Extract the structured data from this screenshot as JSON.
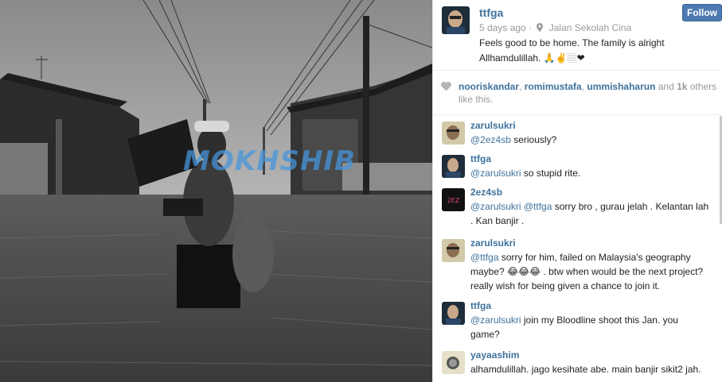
{
  "post": {
    "photo": {
      "description_icon": "flood-photo",
      "watermark": "MOKHSHIB"
    },
    "owner": {
      "username": "ttfga"
    },
    "follow_label": "Follow",
    "time_ago": "5 days ago",
    "separator": "·",
    "location": "Jalan Sekolah Cina",
    "caption": "Feels good to be home. The family is alright Allhamdulillah. 🙏✌️🏼❤"
  },
  "likes": {
    "users": [
      "nooriskandar",
      "romimustafa",
      "ummishaharun"
    ],
    "sep1": ", ",
    "sep2": ", ",
    "and": " and ",
    "count": "1k",
    "suffix": " others like this."
  },
  "comments": [
    {
      "user": "zarulsukri",
      "mention": "@2ez4sb",
      "text": " seriously?"
    },
    {
      "user": "ttfga",
      "mention": "@zarulsukri",
      "text": " so stupid rite."
    },
    {
      "user": "2ez4sb",
      "mention": "@zarulsukri @ttfga",
      "text": " sorry bro , gurau jelah . Kelantan lah . Kan banjir ."
    },
    {
      "user": "zarulsukri",
      "mention": "@ttfga",
      "text": " sorry for him, failed on Malaysia's geography maybe? 😂😂😂 . btw when would be the next project? really wish for being given a chance to join it."
    },
    {
      "user": "ttfga",
      "mention": "@zarulsukri",
      "text": " join my Bloodline shoot this Jan. you game?"
    },
    {
      "user": "yayaashim",
      "mention": "",
      "text": "alhamdulillah. jago kesihate abe. main banjir sikit2 jah."
    }
  ],
  "colors": {
    "link": "#3f729b",
    "follow_bg": "#4d7ab0",
    "muted": "#999999"
  }
}
